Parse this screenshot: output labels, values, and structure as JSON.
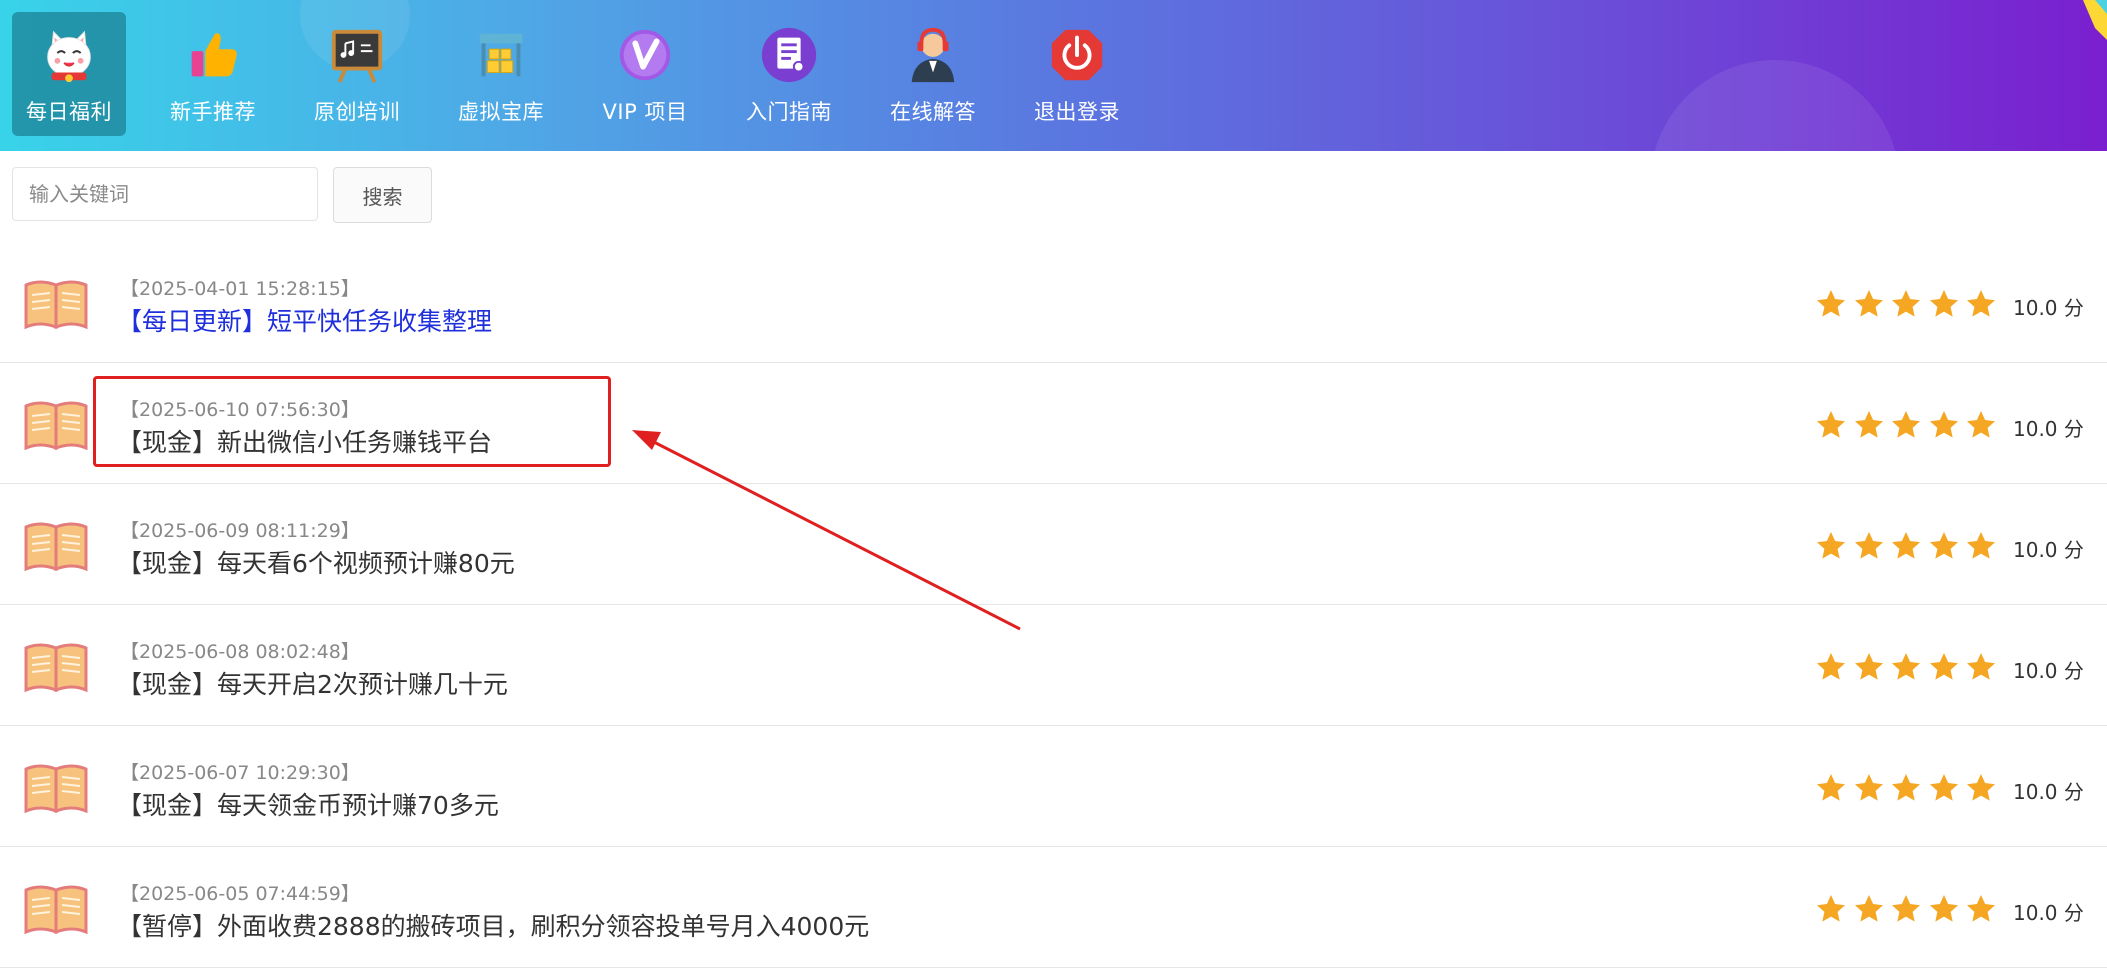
{
  "nav": {
    "items": [
      {
        "label": "每日福利",
        "icon": "lucky-cat-icon",
        "active": true
      },
      {
        "label": "新手推荐",
        "icon": "thumbs-up-icon"
      },
      {
        "label": "原创培训",
        "icon": "chalkboard-icon"
      },
      {
        "label": "虚拟宝库",
        "icon": "treasure-stack-icon"
      },
      {
        "label": "VIP 项目",
        "icon": "vip-badge-icon"
      },
      {
        "label": "入门指南",
        "icon": "document-icon"
      },
      {
        "label": "在线解答",
        "icon": "support-agent-icon"
      },
      {
        "label": "退出登录",
        "icon": "power-icon"
      }
    ]
  },
  "search": {
    "placeholder": "输入关键词",
    "button_label": "搜索"
  },
  "list": {
    "items": [
      {
        "date": "【2025-04-01 15:28:15】",
        "title": "【每日更新】短平快任务收集整理",
        "stars": 5,
        "score": "10.0 分",
        "is_link": true
      },
      {
        "date": "【2025-06-10 07:56:30】",
        "title": "【现金】新出微信小任务赚钱平台",
        "stars": 5,
        "score": "10.0 分",
        "highlighted": true
      },
      {
        "date": "【2025-06-09 08:11:29】",
        "title": "【现金】每天看6个视频预计赚80元",
        "stars": 5,
        "score": "10.0 分"
      },
      {
        "date": "【2025-06-08 08:02:48】",
        "title": "【现金】每天开启2次预计赚几十元",
        "stars": 5,
        "score": "10.0 分"
      },
      {
        "date": "【2025-06-07 10:29:30】",
        "title": "【现金】每天领金币预计赚70多元",
        "stars": 5,
        "score": "10.0 分"
      },
      {
        "date": "【2025-06-05 07:44:59】",
        "title": "【暂停】外面收费2888的搬砖项目，刷积分领容投单号月入4000元",
        "stars": 5,
        "score": "10.0 分"
      }
    ]
  },
  "colors": {
    "header_gradient_start": "#38d3e9",
    "header_gradient_end": "#7a1fcf",
    "star": "#f5a623",
    "link_title": "#1f2fdc",
    "annotation": "#e02020"
  }
}
